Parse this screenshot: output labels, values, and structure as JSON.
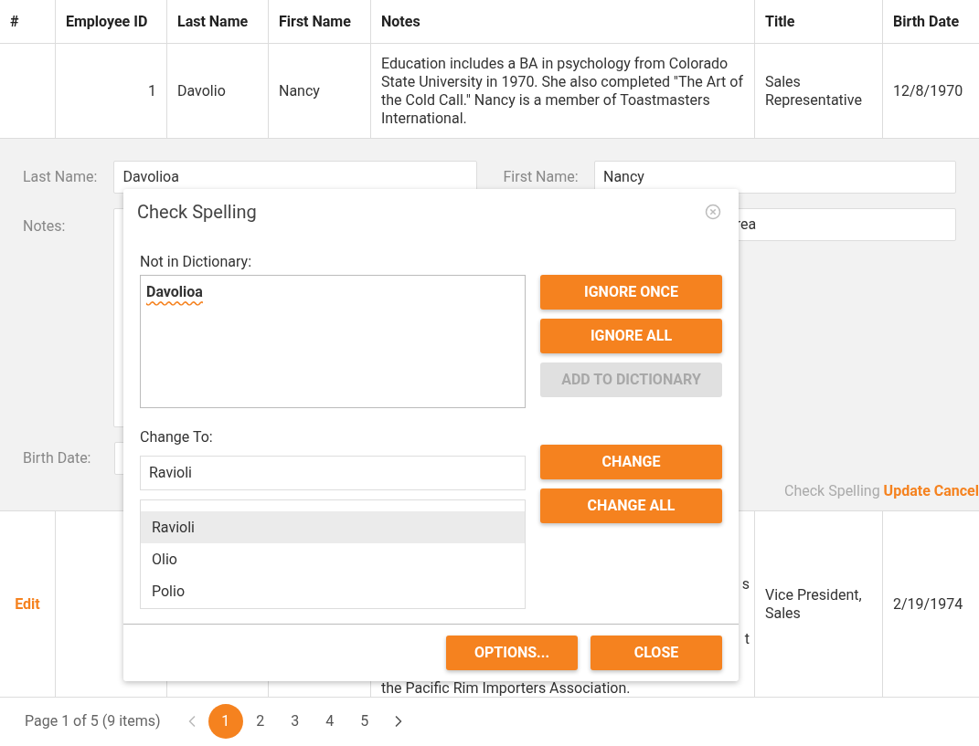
{
  "table": {
    "columns": [
      "#",
      "Employee ID",
      "Last Name",
      "First Name",
      "Notes",
      "Title",
      "Birth Date"
    ],
    "rows": [
      {
        "kind": "data",
        "cells": [
          "",
          "1",
          "Davolio",
          "Nancy",
          "Education includes a BA in psychology from Colorado State University in 1970. She also completed \"The Art of the Cold Call.\" Nancy is a member of Toastmasters International.",
          "Sales Representative",
          "12/8/1970"
        ]
      },
      {
        "kind": "edit"
      },
      {
        "kind": "covered",
        "edit_link": "Edit",
        "notes_fragments": [
          "s",
          "t"
        ],
        "notes_last_line": "the Pacific Rim Importers Association.",
        "title": "Vice President, Sales",
        "birth_date": "2/19/1974"
      }
    ]
  },
  "edit_form": {
    "last_name_label": "Last Name:",
    "last_name_value": "Davolioa",
    "first_name_label": "First Name:",
    "first_name_value": "Nancy",
    "notes_label": "Notes:",
    "title_value_fragment": "rea",
    "birth_date_label": "Birth Date:",
    "links": [
      {
        "label": "Check Spelling",
        "disabled": true
      },
      {
        "label": "Update",
        "disabled": false
      },
      {
        "label": "Cancel",
        "disabled": false
      }
    ]
  },
  "dialog": {
    "title": "Check Spelling",
    "not_in_dictionary_label": "Not in Dictionary:",
    "not_in_dictionary_value": "Davolioa",
    "change_to_label": "Change To:",
    "change_to_value": "Ravioli",
    "suggestions": [
      {
        "label": "Ravioli",
        "selected": true
      },
      {
        "label": "Olio",
        "selected": false
      },
      {
        "label": "Polio",
        "selected": false
      }
    ],
    "top_buttons": [
      {
        "label": "IGNORE ONCE",
        "disabled": false
      },
      {
        "label": "IGNORE ALL",
        "disabled": false
      },
      {
        "label": "ADD TO DICTIONARY",
        "disabled": true
      }
    ],
    "change_buttons": [
      {
        "label": "CHANGE",
        "disabled": false
      },
      {
        "label": "CHANGE ALL",
        "disabled": false
      }
    ],
    "footer_buttons": [
      {
        "label": "OPTIONS...",
        "disabled": false
      },
      {
        "label": "CLOSE",
        "disabled": false
      }
    ]
  },
  "pager": {
    "summary": "Page 1 of 5 (9 items)",
    "pages": [
      {
        "label": "1",
        "selected": true
      },
      {
        "label": "2",
        "selected": false
      },
      {
        "label": "3",
        "selected": false
      },
      {
        "label": "4",
        "selected": false
      },
      {
        "label": "5",
        "selected": false
      }
    ]
  }
}
